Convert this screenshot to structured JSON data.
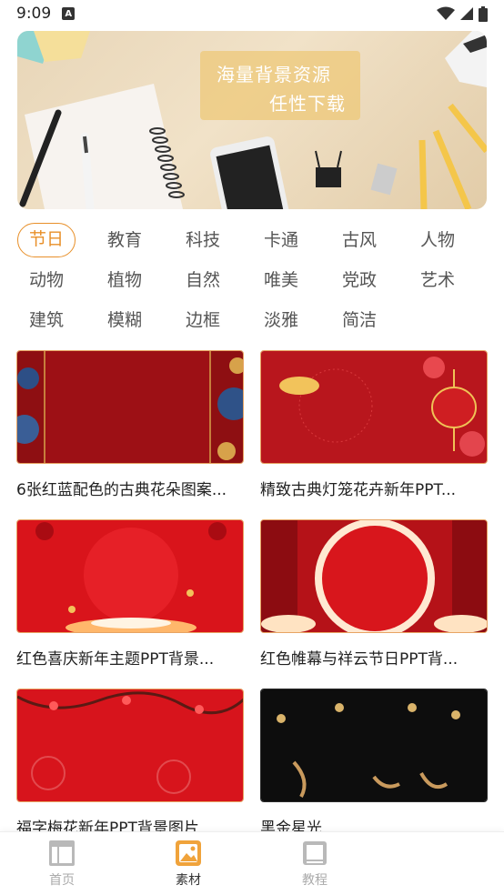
{
  "status_bar": {
    "time": "9:09",
    "notification_icon": "A"
  },
  "banner": {
    "line1": "海量背景资源",
    "line2": "任性下载"
  },
  "categories": [
    {
      "label": "节日",
      "active": true
    },
    {
      "label": "教育"
    },
    {
      "label": "科技"
    },
    {
      "label": "卡通"
    },
    {
      "label": "古风"
    },
    {
      "label": "人物"
    },
    {
      "label": "动物"
    },
    {
      "label": "植物"
    },
    {
      "label": "自然"
    },
    {
      "label": "唯美"
    },
    {
      "label": "党政"
    },
    {
      "label": "艺术"
    },
    {
      "label": "建筑"
    },
    {
      "label": "模糊"
    },
    {
      "label": "边框"
    },
    {
      "label": "淡雅"
    },
    {
      "label": "简洁"
    }
  ],
  "items": [
    {
      "title": "6张红蓝配色的古典花朵图案..."
    },
    {
      "title": "精致古典灯笼花卉新年PPT..."
    },
    {
      "title": "红色喜庆新年主题PPT背景..."
    },
    {
      "title": "红色帷幕与祥云节日PPT背..."
    },
    {
      "title": "福字梅花新年PPT背景图片"
    },
    {
      "title": "黑金星光"
    }
  ],
  "bottom_nav": [
    {
      "label": "首页",
      "icon": "home-icon"
    },
    {
      "label": "素材",
      "icon": "image-icon",
      "active": true
    },
    {
      "label": "教程",
      "icon": "book-icon"
    }
  ],
  "colors": {
    "accent": "#e8902a",
    "festival_red": "#c1121b"
  }
}
